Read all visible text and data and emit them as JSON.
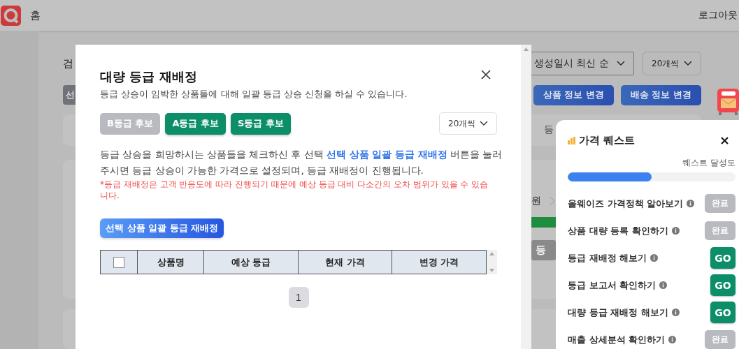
{
  "header": {
    "home": "홈",
    "logout": "로그아웃"
  },
  "page": {
    "search_label": "검",
    "sort_select": "생성일시 최신 순",
    "count_select": "20개씩",
    "left_button": "선",
    "buttons": [
      "상품 정보 변경",
      "배송 정보 변경"
    ],
    "card_label": "등",
    "price_unit": "원",
    "grade_button": "등"
  },
  "modal": {
    "title": "대량 등급 재배정",
    "subtitle": "등급 상승이 임박한 상품들에 대해 일괄 등급 상승 신청을 하실 수 있습니다.",
    "grade_buttons": [
      {
        "label": "B등급 후보",
        "disabled": true
      },
      {
        "label": "A등급 후보",
        "disabled": false
      },
      {
        "label": "S등급 후보",
        "disabled": false
      }
    ],
    "page_size": "20개씩",
    "instruction": "등급 상승을 희망하시는 상품들을 체크하신 후 선택 **선택 상품 일괄 등급 재배정** 버튼을 눌러 주시면 등급 상승이 가능한 가격으로 설정되며, 등급 재배정이 진행됩니다.",
    "note": "*등급 재배정은 고객 반응도에 따라 진행되기 때문에 예상 등급 대비 다소간의 오차 범위가 있을 수 있습니다.",
    "action_button": "선택 상품 일괄 등급 재배정",
    "table": {
      "select_all": false,
      "columns": [
        "상품명",
        "예상 등급",
        "현재 가격",
        "변경 가격"
      ]
    },
    "pagination": [
      {
        "label": "1",
        "selected": true
      }
    ]
  },
  "quest": {
    "title": "가격 퀘스트",
    "progress_label": "퀘스트 달성도",
    "level": 0.5,
    "items": [
      {
        "label": "올웨이즈 가격정책 알아보기",
        "kind": "done",
        "button": "완료"
      },
      {
        "label": "상품 대량 등록 확인하기",
        "kind": "done",
        "button": "완료"
      },
      {
        "label": "등급 재배정 해보기",
        "kind": "go",
        "button": "GO"
      },
      {
        "label": "등급 보고서 확인하기",
        "kind": "go",
        "button": "GO"
      },
      {
        "label": "대량 등급 재배정 해보기",
        "kind": "go",
        "button": "GO"
      },
      {
        "label": "매출 상세분석 확인하기",
        "kind": "done",
        "button": "완료"
      }
    ]
  }
}
